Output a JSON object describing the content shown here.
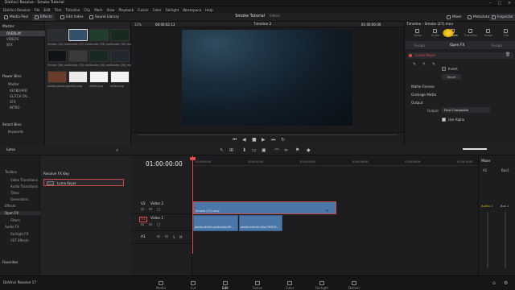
{
  "window": {
    "title": "DaVinci Resolve - Smoke Tutorial"
  },
  "menu": [
    "DaVinci Resolve",
    "File",
    "Edit",
    "Trim",
    "Timeline",
    "Clip",
    "Mark",
    "View",
    "Playback",
    "Fusion",
    "Color",
    "Fairlight",
    "Workspace",
    "Help"
  ],
  "toolbar": {
    "left": [
      "Media Pool",
      "Effects",
      "Edit Index",
      "Sound Library"
    ],
    "project_title": "Smoke Tutorial",
    "project_status": "Edited",
    "right": [
      "Mixer",
      "Metadata",
      "Inspector"
    ]
  },
  "media_pool": {
    "master_label": "Master",
    "bins": [
      "OVERLAY",
      "VIDEOS",
      "SFX"
    ],
    "selected_bin": "OVERLAY",
    "power_bins_label": "Power Bins",
    "power_bins_master": "Master",
    "power_bins": [
      "KEYBOARD",
      "GLITCH OV...",
      "SFX",
      "INTRO"
    ],
    "smart_bins_label": "Smart Bins",
    "smart_bins": [
      "Keywords"
    ],
    "thumbs": [
      {
        "label": "Smoke (10).mov",
        "color": "#2a2d31",
        "sel": false
      },
      {
        "label": "Smoke (27).mov",
        "color": "#35506a",
        "sel": true
      },
      {
        "label": "Smoke (33).mov",
        "color": "#1f3f2c",
        "sel": false
      },
      {
        "label": "Smoke (32).mov",
        "color": "#172a1d",
        "sel": false
      },
      {
        "label": "Smoke (36).mov",
        "color": "#111416",
        "sel": false
      },
      {
        "label": "Smoke (25).mov",
        "color": "#3a3a3a",
        "sel": false
      },
      {
        "label": "Smoke (34).mov",
        "color": "#182921",
        "sel": false
      },
      {
        "label": "Smoke (26).mov",
        "color": "#232830",
        "sel": false
      },
      {
        "label": "pexels-photo.jpg",
        "color": "#6a3a2a",
        "sel": false
      },
      {
        "label": "white.png",
        "color": "#eaeaea",
        "sel": false
      },
      {
        "label": "white.png",
        "color": "#f4f4f4",
        "sel": false
      },
      {
        "label": "white.png",
        "color": "#f4f4f4",
        "sel": false
      }
    ]
  },
  "viewer": {
    "zoom": "33%",
    "timecode_left": "00:00:02:13",
    "timeline_name": "Timeline 2",
    "timecode_right": "01:00:00:00"
  },
  "inspector": {
    "header": "Timeline - Smoke (27).mov",
    "tabs": [
      "Video",
      "Audio",
      "Effects",
      "Transition",
      "Image",
      "File"
    ],
    "subtabs": [
      "Fusion",
      "Open FX",
      "Fusion"
    ],
    "active_subtab": "Open FX",
    "effect_name": "Luma Keyer",
    "invert_label": "Invert",
    "reset_label": "Reset",
    "sections": [
      "Matte Finesse",
      "Garbage Matte",
      "Output"
    ],
    "output_label": "Output",
    "output_value": "Final Composite",
    "use_alpha_label": "Use Alpha"
  },
  "effects": {
    "search_value": "luma",
    "categories": [
      "Toolbox",
      "Video Transitions",
      "Audio Transitions",
      "Titles",
      "Generators",
      "Effects",
      "Open FX",
      "Filters",
      "Audio FX",
      "Fairlight FX",
      "VST Effects"
    ],
    "open_category": "Open FX",
    "favorites_label": "Favorites",
    "section_title": "Resolve FX Key",
    "result": "Luma Keyer"
  },
  "timeline": {
    "timecode": "01:00:00:00",
    "ruler_ticks": [
      "01:00:00:00",
      "01:00:02:00",
      "01:00:04:00",
      "01:00:06:00",
      "01:00:08:00",
      "01:00:10:00"
    ],
    "tracks": [
      {
        "id": "V2",
        "name": "Video 2"
      },
      {
        "id": "V1",
        "name": "Video 1"
      },
      {
        "id": "A1",
        "name": ""
      }
    ],
    "clips": {
      "v2": "Smoke (27).mov",
      "v1a": "pexels-dimitri-production-89...",
      "v1b": "pexels-mikhail-nilov-763531..."
    }
  },
  "mixer": {
    "title": "Mixer",
    "channels": [
      "A1",
      "Bus1"
    ],
    "audio_label": "Audio 1",
    "bus_label": "Bus 1"
  },
  "pages": [
    "Media",
    "Cut",
    "Edit",
    "Fusion",
    "Color",
    "Fairlight",
    "Deliver"
  ],
  "active_page": "Edit",
  "app_name": "DaVinci Resolve 17",
  "colors": {
    "accent": "#e04b4b",
    "clip_blue": "#4a77a8",
    "highlight": "#e6b800"
  }
}
